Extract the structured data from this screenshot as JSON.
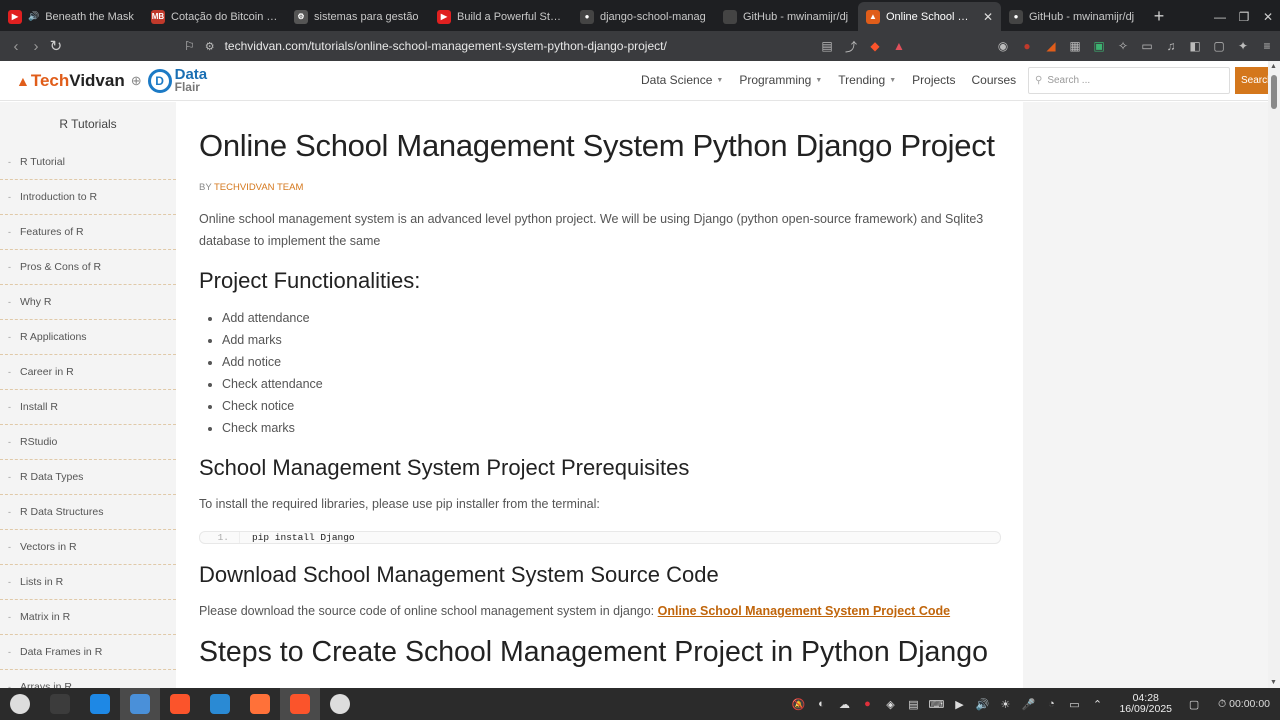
{
  "browser": {
    "tabs": [
      {
        "title": "Beneath the Mask",
        "fav_color": "#e02020",
        "fav_glyph": "▶",
        "extra": "🔊"
      },
      {
        "title": "Cotação do Bitcoin | P",
        "fav_color": "#c0392b",
        "fav_glyph": "MB"
      },
      {
        "title": "sistemas para gestão",
        "fav_color": "#555555",
        "fav_glyph": "⚙"
      },
      {
        "title": "Build a Powerful Stude",
        "fav_color": "#e02020",
        "fav_glyph": "▶"
      },
      {
        "title": "django-school-manag",
        "fav_color": "#444444",
        "fav_glyph": "●"
      },
      {
        "title": "GitHub - mwinamijr/dj",
        "fav_color": "#444444",
        "fav_glyph": ""
      },
      {
        "title": "Online School Man",
        "fav_color": "#e05d1a",
        "fav_glyph": "▲",
        "active": true
      },
      {
        "title": "GitHub - mwinamijr/dj",
        "fav_color": "#444444",
        "fav_glyph": "●"
      }
    ],
    "new_tab": "+",
    "url": "techvidvan.com/tutorials/online-school-management-system-python-django-project/"
  },
  "site": {
    "logo_tech": "Tech",
    "logo_vidvan": "Vidvan",
    "logo_data": "Data",
    "logo_flair": "Flair",
    "menu": [
      {
        "label": "Data Science",
        "dropdown": true
      },
      {
        "label": "Programming",
        "dropdown": true
      },
      {
        "label": "Trending",
        "dropdown": true
      },
      {
        "label": "Projects",
        "dropdown": false
      },
      {
        "label": "Courses",
        "dropdown": false
      }
    ],
    "search_placeholder": "Search ...",
    "search_button": "Search"
  },
  "sidebar": {
    "title": "R Tutorials",
    "items": [
      "R Tutorial",
      "Introduction to R",
      "Features of R",
      "Pros & Cons of R",
      "Why R",
      "R Applications",
      "Career in R",
      "Install R",
      "RStudio",
      "R Data Types",
      "R Data Structures",
      "Vectors in R",
      "Lists in R",
      "Matrix in R",
      "Data Frames in R",
      "Arrays in R"
    ]
  },
  "article": {
    "title": "Online School Management System Python Django Project",
    "by": "BY",
    "author": "TECHVIDVAN TEAM",
    "intro": "Online school management system is an advanced level python project. We will be using Django (python open-source framework) and Sqlite3 database to implement the same",
    "functionalities_heading": "Project Functionalities:",
    "functionalities": [
      "Add attendance",
      "Add marks",
      "Add notice",
      "Check attendance",
      "Check notice",
      "Check marks"
    ],
    "prereq_heading": "School Management System Project Prerequisites",
    "prereq_text": "To install the required libraries, please use pip installer from the terminal:",
    "code_line_no": "1.",
    "code": "pip install Django",
    "download_heading": "Download School Management System Source Code",
    "download_text": "Please download the source code of online school management system in django:",
    "download_link": "Online School Management System Project Code",
    "steps_heading": "Steps to Create School Management Project in Python Django"
  },
  "taskbar": {
    "apps": [
      {
        "name": "system-menu",
        "color": "#dddddd"
      },
      {
        "name": "terminal",
        "color": "#3c3c3c"
      },
      {
        "name": "store",
        "color": "#1e88e5"
      },
      {
        "name": "files",
        "color": "#4a90d9",
        "active": true
      },
      {
        "name": "brave",
        "color": "#fb542b"
      },
      {
        "name": "vscode",
        "color": "#2a8ad4"
      },
      {
        "name": "firefox",
        "color": "#ff7139"
      },
      {
        "name": "brave-active",
        "color": "#fb542b",
        "active": true
      },
      {
        "name": "obs",
        "color": "#dddddd"
      }
    ],
    "time": "04:28",
    "date": "16/09/2025",
    "timer": "00:00:00"
  }
}
